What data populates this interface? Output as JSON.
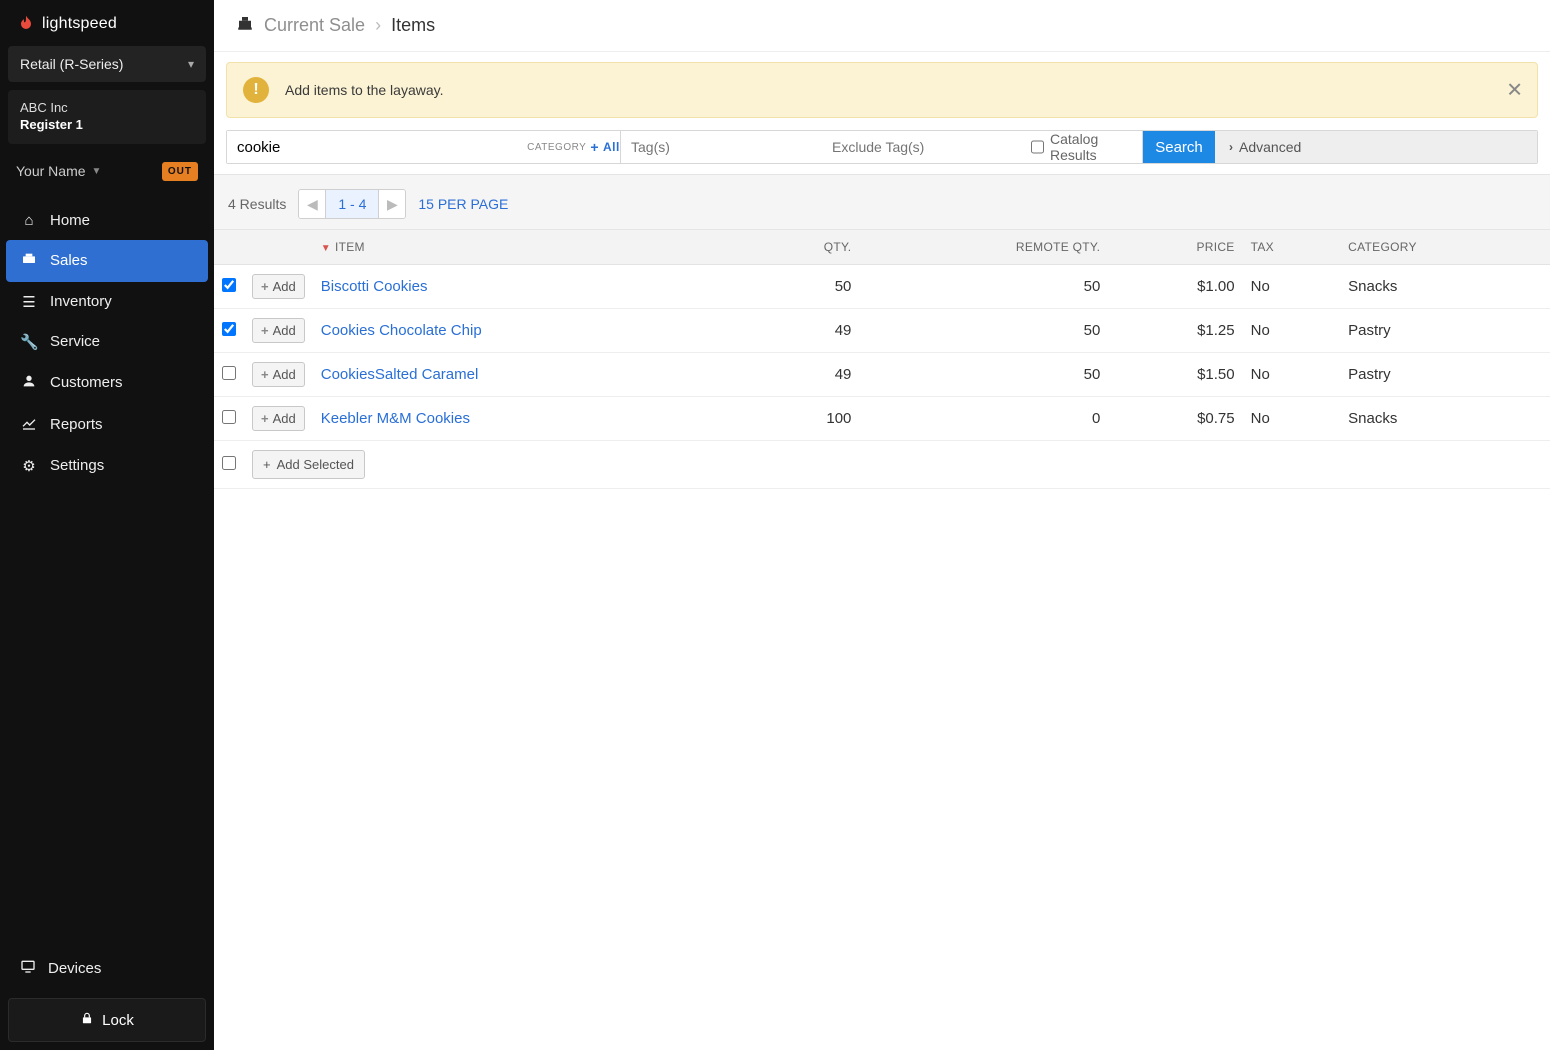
{
  "brand": {
    "name": "lightspeed"
  },
  "sidebar": {
    "series_label": "Retail (R-Series)",
    "store": {
      "company": "ABC Inc",
      "register": "Register 1"
    },
    "user": {
      "name": "Your Name",
      "out_badge": "OUT"
    },
    "nav": [
      {
        "label": "Home",
        "icon": "home-icon"
      },
      {
        "label": "Sales",
        "icon": "sales-icon",
        "active": true
      },
      {
        "label": "Inventory",
        "icon": "inventory-icon"
      },
      {
        "label": "Service",
        "icon": "service-icon"
      },
      {
        "label": "Customers",
        "icon": "customers-icon"
      },
      {
        "label": "Reports",
        "icon": "reports-icon"
      },
      {
        "label": "Settings",
        "icon": "settings-icon"
      }
    ],
    "devices_label": "Devices",
    "lock_label": "Lock"
  },
  "breadcrumb": {
    "parent": "Current Sale",
    "current": "Items"
  },
  "banner": {
    "text": "Add items to the layaway."
  },
  "search": {
    "value": "cookie",
    "category_label": "CATEGORY",
    "category_all": "All",
    "tags_placeholder": "Tag(s)",
    "exclude_placeholder": "Exclude Tag(s)",
    "catalog_label": "Catalog Results",
    "search_label": "Search",
    "advanced_label": "Advanced"
  },
  "results_meta": {
    "count_text": "4 Results",
    "range": "1 - 4",
    "per_page": "15 PER PAGE"
  },
  "columns": {
    "item": "ITEM",
    "qty": "QTY.",
    "remote_qty": "REMOTE QTY.",
    "price": "PRICE",
    "tax": "TAX",
    "category": "CATEGORY"
  },
  "add_label": "Add",
  "add_selected_label": "Add Selected",
  "rows": [
    {
      "checked": true,
      "name": "Biscotti Cookies",
      "qty": "50",
      "remote": "50",
      "price": "$1.00",
      "tax": "No",
      "category": "Snacks"
    },
    {
      "checked": true,
      "name": "Cookies Chocolate Chip",
      "qty": "49",
      "remote": "50",
      "price": "$1.25",
      "tax": "No",
      "category": "Pastry"
    },
    {
      "checked": false,
      "name": "CookiesSalted Caramel",
      "qty": "49",
      "remote": "50",
      "price": "$1.50",
      "tax": "No",
      "category": "Pastry"
    },
    {
      "checked": false,
      "name": "Keebler M&M Cookies",
      "qty": "100",
      "remote": "0",
      "price": "$0.75",
      "tax": "No",
      "category": "Snacks"
    }
  ]
}
